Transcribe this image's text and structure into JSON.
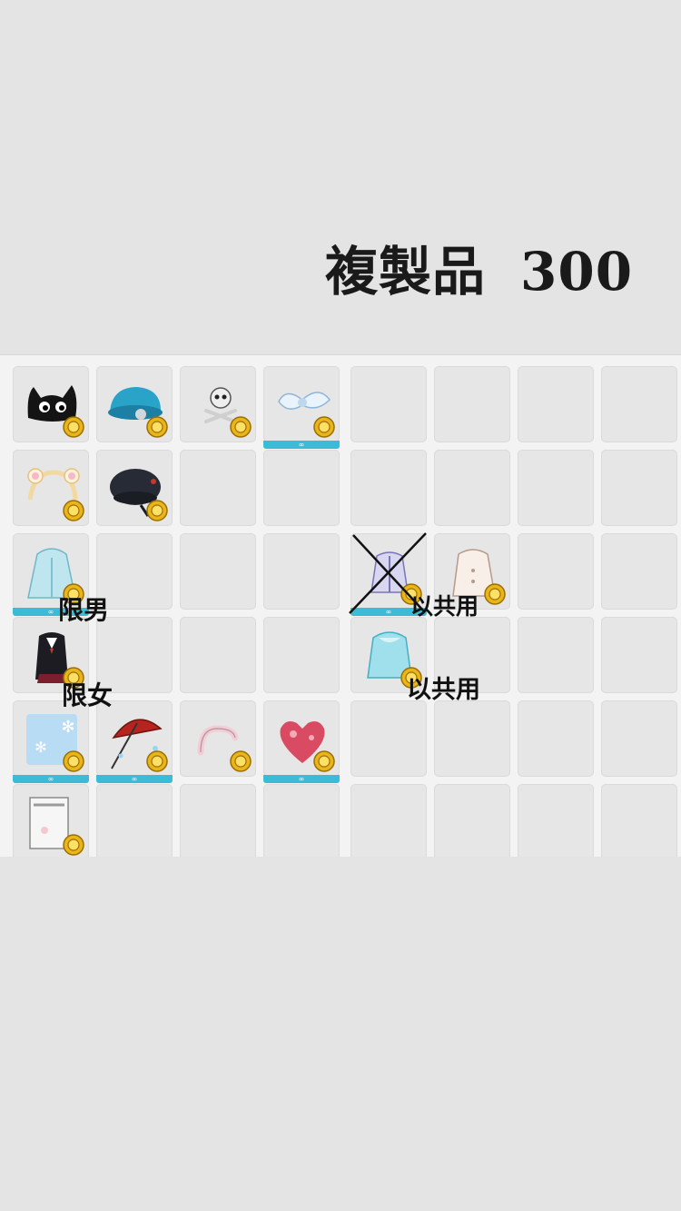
{
  "header": {
    "title": "複製品",
    "count": "300"
  },
  "notes": {
    "male_only": "限男",
    "female_only": "限女",
    "shared_1": "以共用",
    "shared_2": "以共用"
  },
  "inventory": {
    "infinity_mark": "∞",
    "items": [
      {
        "row": 0,
        "col": 0,
        "name": "black-cat-hat-icon"
      },
      {
        "row": 0,
        "col": 1,
        "name": "blue-cat-cap-icon"
      },
      {
        "row": 0,
        "col": 2,
        "name": "skull-accessory-icon"
      },
      {
        "row": 0,
        "col": 3,
        "name": "white-ribbon-icon",
        "permanent": true
      },
      {
        "row": 1,
        "col": 0,
        "name": "bear-ear-headband-icon"
      },
      {
        "row": 1,
        "col": 1,
        "name": "black-beret-icon"
      },
      {
        "row": 2,
        "col": 0,
        "name": "blue-hooded-coat-icon",
        "permanent": true
      },
      {
        "row": 2,
        "col": 4,
        "name": "purple-outfit-icon",
        "permanent": true,
        "crossed": true
      },
      {
        "row": 2,
        "col": 5,
        "name": "white-blouse-icon"
      },
      {
        "row": 3,
        "col": 0,
        "name": "black-school-uniform-icon"
      },
      {
        "row": 3,
        "col": 4,
        "name": "light-blue-coat-icon"
      },
      {
        "row": 4,
        "col": 0,
        "name": "snowflake-effect-icon",
        "permanent": true
      },
      {
        "row": 4,
        "col": 1,
        "name": "red-parasol-icon",
        "permanent": true
      },
      {
        "row": 4,
        "col": 2,
        "name": "pink-worm-icon"
      },
      {
        "row": 4,
        "col": 3,
        "name": "red-heart-crystals-icon",
        "permanent": true
      },
      {
        "row": 5,
        "col": 0,
        "name": "paper-note-icon"
      }
    ]
  }
}
